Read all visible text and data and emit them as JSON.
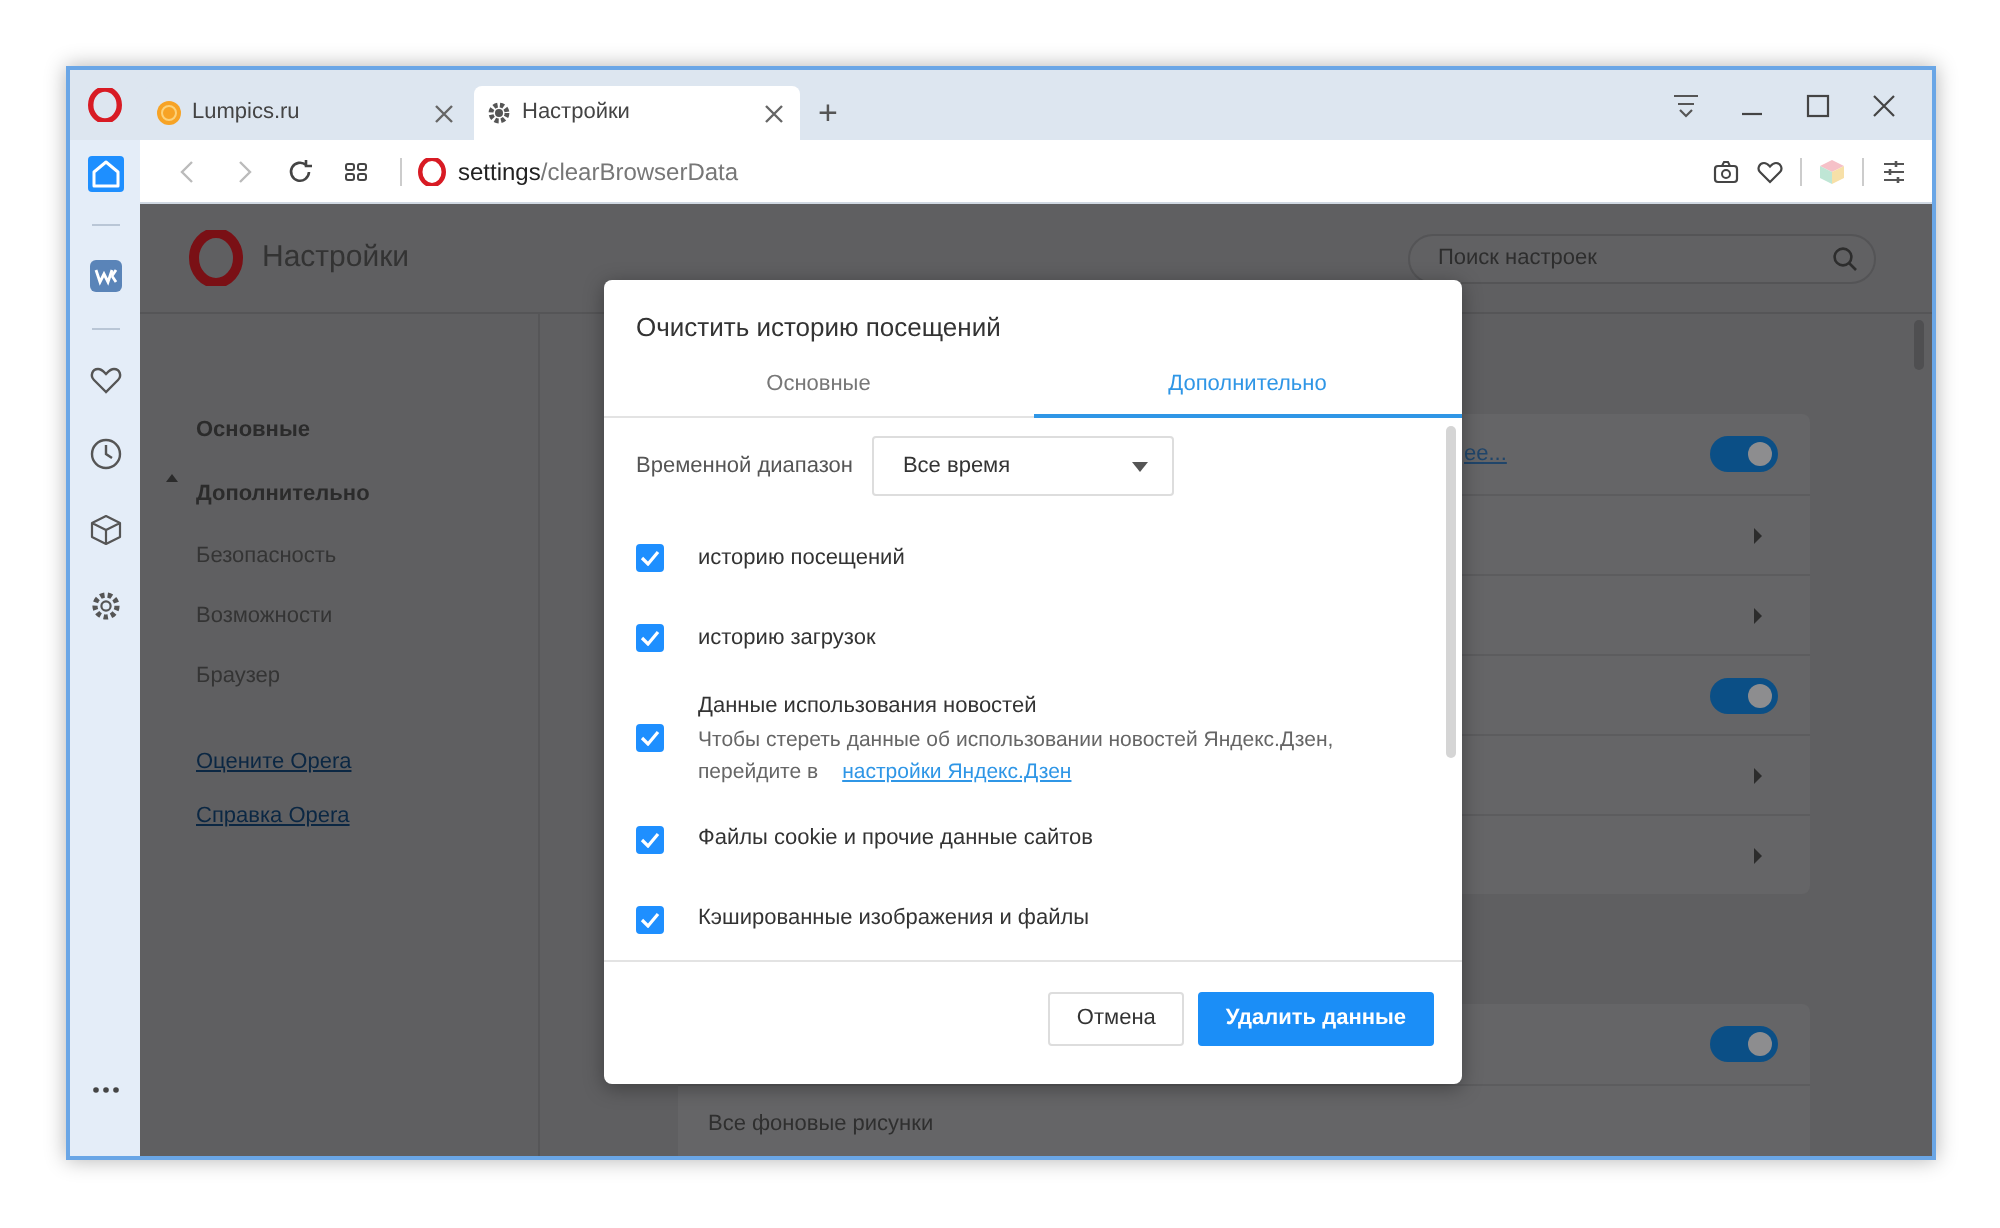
{
  "browser": {
    "tabs": [
      {
        "title": "Lumpics.ru",
        "selected": false
      },
      {
        "title": "Настройки",
        "selected": true
      }
    ],
    "new_tab": "+",
    "address": "**settings**/clearBrowserData"
  },
  "sidebar": {
    "items": [
      {
        "selected": true
      },
      {
        "selected": false
      },
      {
        "selected": false
      },
      {
        "selected": false
      },
      {
        "selected": false
      },
      {
        "selected": false
      }
    ]
  },
  "settings": {
    "title": "Настройки",
    "search": {
      "placeholder": "Поиск настроек"
    },
    "nav": [
      {
        "label": "Основные",
        "expanded": false
      },
      {
        "label": "Дополнительно",
        "expanded": true,
        "children": [
          {
            "label": "Безопасность"
          },
          {
            "label": "Возможности"
          },
          {
            "label": "Браузер"
          }
        ]
      }
    ],
    "links": [
      "Оцените Opera",
      "Справка Opera"
    ],
    "cards": [
      {
        "rows": [
          {
            "kind": "toggle",
            "on": true,
            "link": "ее..."
          },
          {
            "kind": "chevron"
          },
          {
            "kind": "chevron"
          },
          {
            "kind": "toggle",
            "on": true
          },
          {
            "kind": "chevron"
          },
          {
            "kind": "chevron"
          }
        ]
      },
      {
        "rows": [
          {
            "kind": "toggle",
            "on": true
          },
          {
            "kind": "text",
            "label": "Все фоновые рисунки"
          }
        ]
      }
    ]
  },
  "dialog": {
    "title": "Очистить историю посещений",
    "tabs": [
      {
        "label": "Основные",
        "selected": false
      },
      {
        "label": "Дополнительно",
        "selected": true
      }
    ],
    "time_range": {
      "label": "Временной диапазон",
      "value": "Все время"
    },
    "items": [
      {
        "label": "историю посещений",
        "checked": true
      },
      {
        "label": "историю загрузок",
        "checked": true
      },
      {
        "label": "Данные использования новостей",
        "checked": true,
        "description": "Чтобы стереть данные об использовании новостей Яндекс.Дзен, перейдите в",
        "link": "настройки Яндекс.Дзен"
      },
      {
        "label": "Файлы cookie и прочие данные сайтов",
        "checked": true
      },
      {
        "label": "Кэшированные изображения и файлы",
        "checked": true
      }
    ],
    "buttons": [
      {
        "label": "Отмена",
        "kind": "secondary"
      },
      {
        "label": "Удалить данные",
        "kind": "primary"
      }
    ]
  }
}
